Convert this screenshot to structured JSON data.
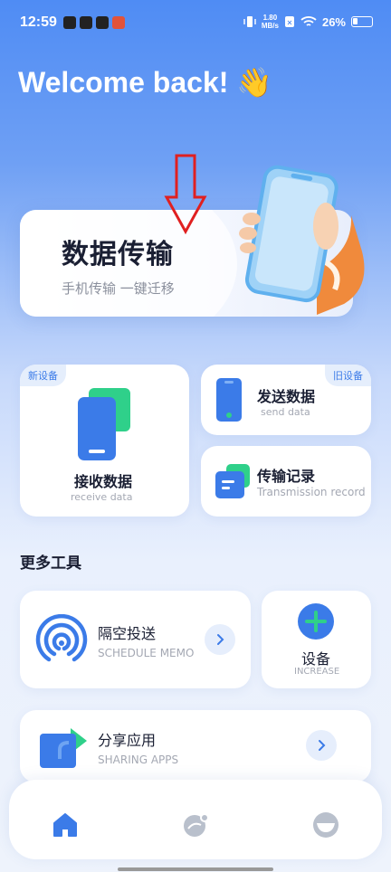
{
  "status_bar": {
    "time": "12:59",
    "net_speed_value": "1.80",
    "net_speed_unit": "MB/s",
    "battery": "26%"
  },
  "welcome": {
    "text": "Welcome back!",
    "emoji": "👋"
  },
  "transfer": {
    "title": "数据传输",
    "subtitle": "手机传输 一键迁移"
  },
  "receive": {
    "tag": "新设备",
    "title": "接收数据",
    "subtitle": "receive data"
  },
  "send": {
    "tag": "旧设备",
    "title": "发送数据",
    "subtitle": "send data"
  },
  "record": {
    "title": "传输记录",
    "subtitle": "Transmission record"
  },
  "more_tools": {
    "heading": "更多工具"
  },
  "airdrop": {
    "title": "隔空投送",
    "subtitle": "SCHEDULE MEMO"
  },
  "device": {
    "title": "设备",
    "subtitle": "INCREASE"
  },
  "share": {
    "title": "分享应用",
    "subtitle": "SHARING APPS"
  },
  "nav": {
    "items": [
      "home-icon",
      "discover-icon",
      "profile-icon"
    ],
    "active": "home"
  },
  "colors": {
    "accent": "#3b7be8",
    "green": "#2fd08a",
    "arrow_red": "#e02020"
  }
}
